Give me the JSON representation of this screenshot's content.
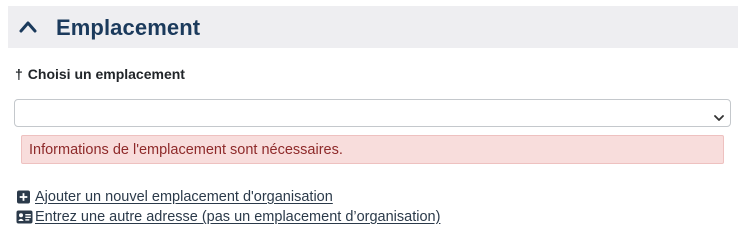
{
  "section": {
    "title": "Emplacement",
    "collapse_icon": "chevron-up-icon"
  },
  "location_field": {
    "required_marker": "†",
    "label": "Choisi un emplacement",
    "selected_value": "",
    "caret_icon": "chevron-down-icon"
  },
  "validation": {
    "error_message": "Informations de l'emplacement sont nécessaires.",
    "colors": {
      "background": "#f8dddc",
      "border": "#eec1c0",
      "text": "#8e2a2a"
    }
  },
  "links": [
    {
      "icon": "plus-square-icon",
      "label": "Ajouter un nouvel emplacement d'organisation"
    },
    {
      "icon": "address-card-icon",
      "label": "Entrez une autre adresse (pas un emplacement d’organisation)"
    }
  ],
  "colors": {
    "header_background": "#eeeef1",
    "header_text": "#1b3a5c",
    "link_text": "#2b3a4a"
  }
}
